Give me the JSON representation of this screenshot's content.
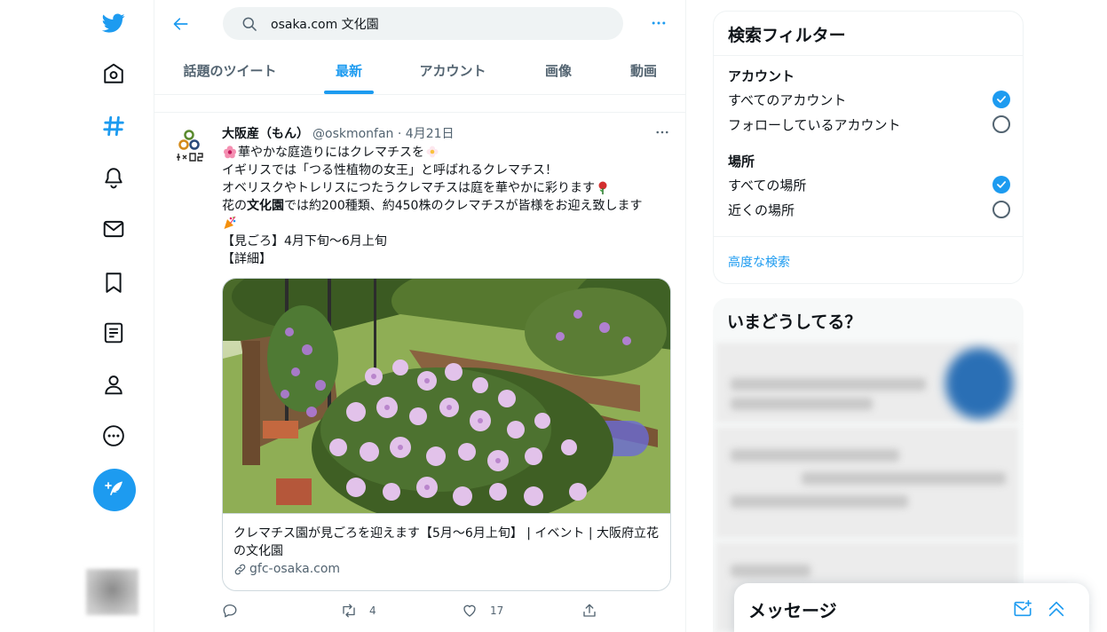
{
  "search": {
    "query": "osaka.com 文化園"
  },
  "tabs": [
    {
      "label": "話題のツイート"
    },
    {
      "label": "最新"
    },
    {
      "label": "アカウント"
    },
    {
      "label": "画像"
    },
    {
      "label": "動画"
    }
  ],
  "active_tab": "最新",
  "tweet": {
    "author_name": "大阪産（もん）",
    "handle": "@oskmonfan",
    "date": "4月21日",
    "lines": {
      "l1": "華やかな庭造りにはクレマチスを",
      "l2": "イギリスでは「つる性植物の女王」と呼ばれるクレマチス！",
      "l3": "オベリスクやトレリスにつたうクレマチスは庭を華やかに彩ります",
      "l4_pre": "花の",
      "l4_bold": "文化園",
      "l4_post": "では約200種類、約450株のクレマチスが皆様をお迎え致します",
      "l6": "【見ごろ】4月下旬～6月上旬",
      "l7": "【詳細】"
    },
    "card": {
      "title": "クレマチス園が見ごろを迎えます【5月～6月上旬】 | イベント | 大阪府立花の文化園",
      "domain": "gfc-osaka.com"
    },
    "actions": {
      "reply_count": "",
      "retweet_count": "4",
      "like_count": "17"
    }
  },
  "filter": {
    "title": "検索フィルター",
    "account_section": "アカウント",
    "account_options": [
      "すべてのアカウント",
      "フォローしているアカウント"
    ],
    "location_section": "場所",
    "location_options": [
      "すべての場所",
      "近くの場所"
    ],
    "advanced_link": "高度な検索"
  },
  "trends": {
    "title": "いまどうしてる？"
  },
  "messages": {
    "title": "メッセージ"
  },
  "colors": {
    "accent": "#1d9bf0",
    "text": "#0f1419",
    "secondary": "#536471",
    "border": "#eff3f4"
  }
}
